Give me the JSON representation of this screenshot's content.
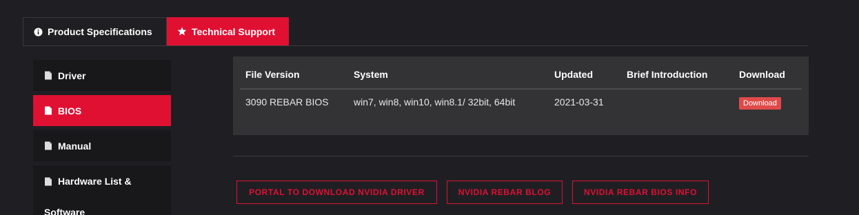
{
  "tabs": {
    "product_specs": "Product Specifications",
    "technical_support": "Technical Support"
  },
  "sidebar": {
    "items": [
      {
        "label": "Driver"
      },
      {
        "label": "BIOS"
      },
      {
        "label": "Manual"
      },
      {
        "label": "Hardware List &",
        "label2": "Software"
      }
    ]
  },
  "table": {
    "headers": [
      "File Version",
      "System",
      "Updated",
      "Brief Introduction",
      "Download"
    ],
    "rows": [
      {
        "file_version": "3090 REBAR BIOS",
        "system": "win7, win8, win10, win8.1/ 32bit, 64bit",
        "updated": "2021-03-31",
        "brief": "",
        "download_label": "Download"
      }
    ]
  },
  "links": [
    "PORTAL TO DOWNLOAD NVIDIA DRIVER",
    "NVIDIA REBAR BLOG",
    "NVIDIA REBAR BIOS INFO"
  ],
  "colors": {
    "accent": "#e01033",
    "background": "#1f1f23",
    "panel": "#333335"
  },
  "icons": {
    "product_specs": "info-icon",
    "technical_support": "star-icon",
    "sidebar": "document-icon"
  }
}
